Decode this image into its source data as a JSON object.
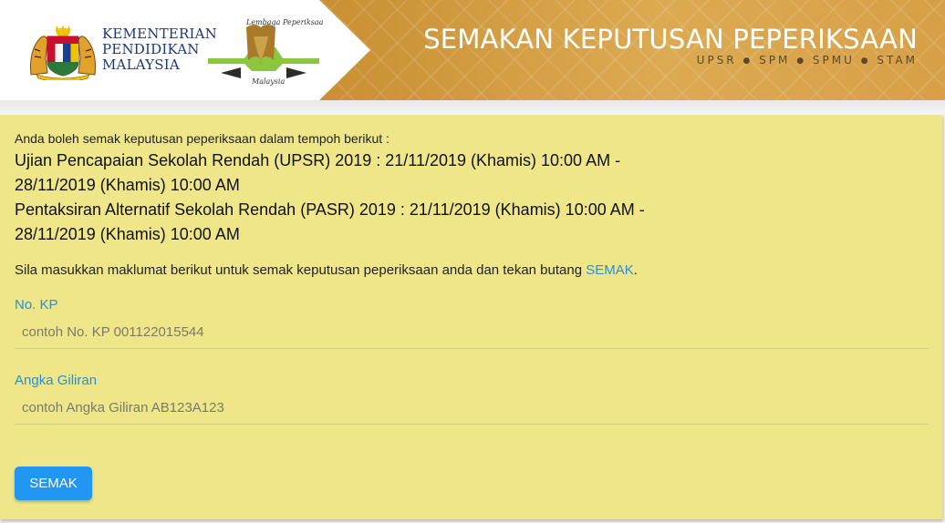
{
  "header": {
    "ministry_lines": [
      "KEMENTERIAN",
      "PENDIDIKAN",
      "MALAYSIA"
    ],
    "lp_logo_top": "Lembaga Peperiksaan",
    "lp_logo_bottom": "Malaysia",
    "title": "SEMAKAN KEPUTUSAN PEPERIKSAAN",
    "subtitle_items": [
      "UPSR",
      "SPM",
      "SPMU",
      "STAM"
    ],
    "colors": {
      "banner": "#d29a3b",
      "card": "#efe68a",
      "accent": "#2196f3"
    }
  },
  "main": {
    "intro": "Anda boleh semak keputusan peperiksaan dalam tempoh berikut :",
    "exam_lines": [
      "Ujian Pencapaian Sekolah Rendah (UPSR) 2019 : 21/11/2019 (Khamis) 10:00 AM -",
      "28/11/2019 (Khamis) 10:00 AM",
      "Pentaksiran Alternatif Sekolah Rendah (PASR) 2019 : 21/11/2019 (Khamis) 10:00 AM -",
      "28/11/2019 (Khamis) 10:00 AM"
    ],
    "instruction": "Sila masukkan maklumat berikut untuk semak keputusan peperiksaan anda dan tekan butang ",
    "instruction_link": "SEMAK",
    "instruction_end": ".",
    "fields": {
      "kp": {
        "label": "No. KP",
        "placeholder": "contoh No. KP 001122015544",
        "value": ""
      },
      "giliran": {
        "label": "Angka Giliran",
        "placeholder": "contoh Angka Giliran AB123A123",
        "value": ""
      }
    },
    "submit_label": "SEMAK"
  }
}
